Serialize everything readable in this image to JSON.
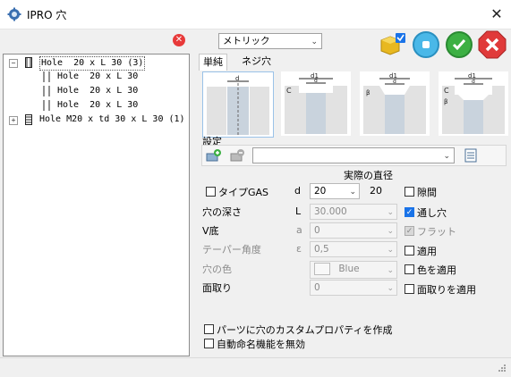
{
  "window": {
    "title": "IPRO 穴",
    "close_glyph": "✕"
  },
  "tree": {
    "root_label": "Hole  20 x L 30 (3)",
    "children": [
      "Hole  20 x L 30",
      "Hole  20 x L 30",
      "Hole  20 x L 30"
    ],
    "second_label": "Hole M20 x td 30 x L 30 (1)",
    "expand_minus": "−",
    "expand_plus": "+"
  },
  "delete_glyph": "✕",
  "unit_select": {
    "value": "メトリック"
  },
  "tabs": {
    "simple": "単純",
    "thread": "ネジ穴"
  },
  "diagram_labels": {
    "d": "d",
    "d1": "d1",
    "c": "C",
    "beta": "β"
  },
  "section": {
    "settings": "設定",
    "actual_diameter": "実際の直径"
  },
  "form": {
    "type_gas": "タイプGAS",
    "diameter_symbol": "d",
    "diameter_value": "20",
    "diameter_actual": "20",
    "clearance": "隙間",
    "depth_label": "穴の深さ",
    "depth_symbol": "L",
    "depth_value": "30.000",
    "through": "通し穴",
    "v_bottom_label": "V底",
    "v_bottom_symbol": "a",
    "v_bottom_value": "0",
    "flat": "フラット",
    "taper_label": "テーパー角度",
    "taper_symbol": "ε",
    "taper_value": "0,5",
    "apply": "適用",
    "color_label": "穴の色",
    "color_value": "Blue",
    "apply_color": "色を適用",
    "chamfer_label": "面取り",
    "chamfer_value": "0",
    "apply_chamfer": "面取りを適用",
    "custom_props": "パーツに穴のカスタムプロパティを作成",
    "disable_autoname": "自動命名機能を無効"
  },
  "check_glyph": "✓",
  "arrow_glyph": "⌄",
  "colors": {
    "ok": "#3cb043",
    "cancel": "#e03a3a",
    "info": "#4ab8e8",
    "accent": "#1a73e8"
  }
}
